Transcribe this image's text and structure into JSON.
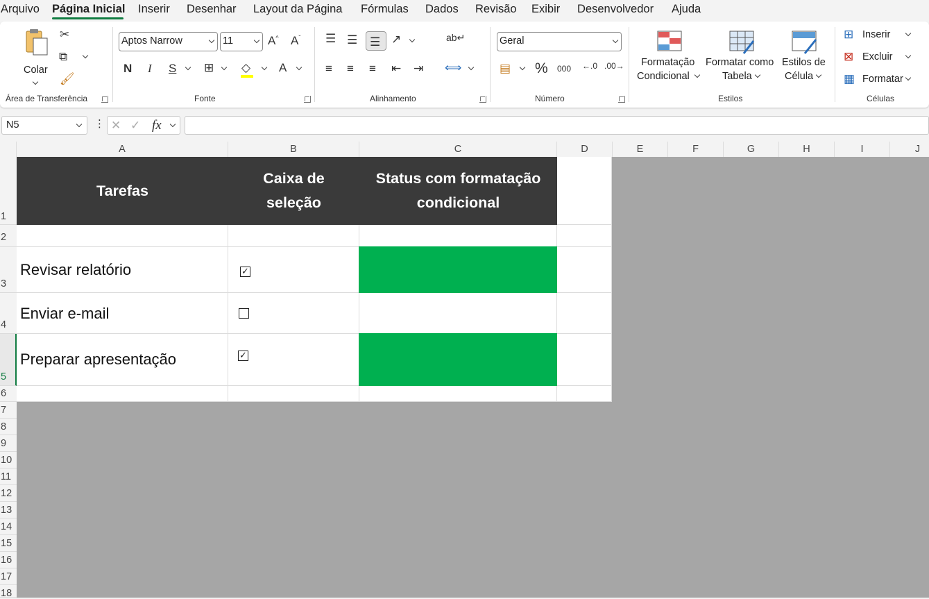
{
  "menu": {
    "tabs": [
      "Arquivo",
      "Página Inicial",
      "Inserir",
      "Desenhar",
      "Layout da Página",
      "Fórmulas",
      "Dados",
      "Revisão",
      "Exibir",
      "Desenvolvedor",
      "Ajuda"
    ],
    "active_tab": "Página Inicial"
  },
  "ribbon": {
    "clipboard": {
      "paste_label": "Colar",
      "group_label": "Área de Transferência"
    },
    "font": {
      "font_name": "Aptos Narrow",
      "font_size": "11",
      "bold": "N",
      "italic": "I",
      "underline": "S",
      "group_label": "Fonte"
    },
    "alignment": {
      "group_label": "Alinhamento"
    },
    "number": {
      "format": "Geral",
      "percent": "%",
      "thousands": "000",
      "group_label": "Número"
    },
    "styles": {
      "conditional_line1": "Formatação",
      "conditional_line2": "Condicional",
      "table_line1": "Formatar como",
      "table_line2": "Tabela",
      "cell_line1": "Estilos de",
      "cell_line2": "Célula",
      "group_label": "Estilos"
    },
    "cells": {
      "insert": "Inserir",
      "delete": "Excluir",
      "format": "Formatar",
      "group_label": "Células"
    }
  },
  "formula_bar": {
    "name_box": "N5",
    "fx": "fx",
    "formula": ""
  },
  "columns": [
    "A",
    "B",
    "C",
    "D",
    "E",
    "F",
    "G",
    "H",
    "I",
    "J"
  ],
  "rows": [
    "1",
    "2",
    "3",
    "4",
    "5",
    "6",
    "7",
    "8",
    "9",
    "10",
    "11",
    "12",
    "13",
    "14",
    "15",
    "16",
    "17",
    "18"
  ],
  "selected_row": "5",
  "table": {
    "headers": [
      "Tarefas",
      "Caixa de seleção",
      "Status com formatação condicional"
    ],
    "tasks": [
      {
        "name": "Revisar relatório",
        "checked": true,
        "status_color": "#00b050"
      },
      {
        "name": "Enviar e-mail",
        "checked": false,
        "status_color": ""
      },
      {
        "name": "Preparar apresentação",
        "checked": true,
        "status_color": "#00b050"
      }
    ]
  },
  "colors": {
    "header_bg": "#3a3a3a",
    "status_green": "#00b050",
    "accent": "#107c41",
    "outside_area": "#a6a6a6"
  }
}
